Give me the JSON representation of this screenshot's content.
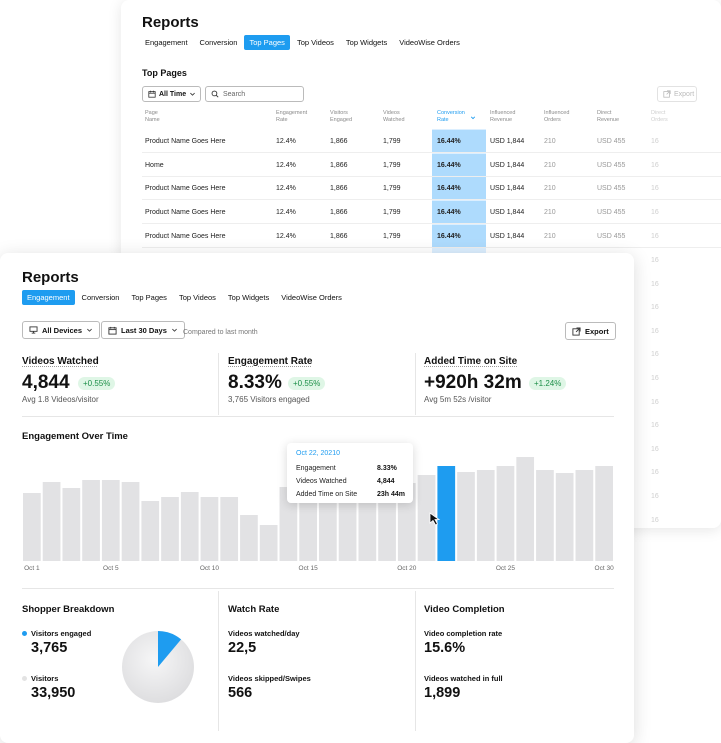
{
  "back": {
    "title": "Reports",
    "tabs": [
      {
        "label": "Engagement",
        "active": false
      },
      {
        "label": "Conversion",
        "active": false
      },
      {
        "label": "Top Pages",
        "active": true
      },
      {
        "label": "Top Videos",
        "active": false
      },
      {
        "label": "Top Widgets",
        "active": false
      },
      {
        "label": "VideoWise Orders",
        "active": false
      }
    ],
    "section_title": "Top Pages",
    "time_filter": "All Time",
    "search_placeholder": "Search",
    "export_label": "Export",
    "columns": [
      {
        "line1": "Page",
        "line2": "Name"
      },
      {
        "line1": "Engagement",
        "line2": "Rate"
      },
      {
        "line1": "Visitors",
        "line2": "Engaged"
      },
      {
        "line1": "Videos",
        "line2": "Watched"
      },
      {
        "line1": "Conversion",
        "line2": "Rate"
      },
      {
        "line1": "Influenced",
        "line2": "Revenue"
      },
      {
        "line1": "Influenced",
        "line2": "Orders"
      },
      {
        "line1": "Direct",
        "line2": "Revenue"
      },
      {
        "line1": "Direct",
        "line2": "Orders"
      }
    ],
    "rows": [
      [
        "Product Name Goes Here",
        "12.4%",
        "1,866",
        "1,799",
        "16.44%",
        "USD 1,844",
        "210",
        "USD 455",
        "16"
      ],
      [
        "Home",
        "12.4%",
        "1,866",
        "1,799",
        "16.44%",
        "USD 1,844",
        "210",
        "USD 455",
        "16"
      ],
      [
        "Product Name Goes Here",
        "12.4%",
        "1,866",
        "1,799",
        "16.44%",
        "USD 1,844",
        "210",
        "USD 455",
        "16"
      ],
      [
        "Product Name Goes Here",
        "12.4%",
        "1,866",
        "1,799",
        "16.44%",
        "USD 1,844",
        "210",
        "USD 455",
        "16"
      ],
      [
        "Product Name Goes Here",
        "12.4%",
        "1,866",
        "1,799",
        "16.44%",
        "USD 1,844",
        "210",
        "USD 455",
        "16"
      ]
    ],
    "direct_orders_extra": [
      "16",
      "16",
      "16",
      "16",
      "16",
      "16",
      "16",
      "16",
      "16",
      "16",
      "16",
      "16"
    ]
  },
  "front": {
    "title": "Reports",
    "tabs": [
      {
        "label": "Engagement",
        "active": true
      },
      {
        "label": "Conversion",
        "active": false
      },
      {
        "label": "Top Pages",
        "active": false
      },
      {
        "label": "Top Videos",
        "active": false
      },
      {
        "label": "Top Widgets",
        "active": false
      },
      {
        "label": "VideoWise Orders",
        "active": false
      }
    ],
    "device_filter": "All Devices",
    "date_filter": "Last 30 Days",
    "compare_text": "Compared to last month",
    "export_label": "Export",
    "metrics": [
      {
        "title": "Videos Watched",
        "value": "4,844",
        "change": "+0.55%",
        "sub": "Avg 1.8 Videos/visitor"
      },
      {
        "title": "Engagement Rate",
        "value": "8.33%",
        "change": "+0.55%",
        "sub": "3,765 Visitors engaged"
      },
      {
        "title": "Added Time on Site",
        "value": "+920h 32m",
        "change": "+1.24%",
        "sub": "Avg 5m 52s /visitor"
      }
    ],
    "chart_title": "Engagement Over Time",
    "tooltip": {
      "date": "Oct 22, 20210",
      "rows": [
        {
          "label": "Engagement",
          "value": "8.33%"
        },
        {
          "label": "Videos Watched",
          "value": "4,844"
        },
        {
          "label": "Added Time on Site",
          "value": "23h 44m"
        }
      ]
    },
    "shopper": {
      "title": "Shopper Breakdown",
      "engaged_label": "Visitors engaged",
      "engaged_value": "3,765",
      "visitors_label": "Visitors",
      "visitors_value": "33,950"
    },
    "watch_rate": {
      "title": "Watch Rate",
      "a_label": "Videos watched/day",
      "a_value": "22,5",
      "b_label": "Videos skipped/Swipes",
      "b_value": "566"
    },
    "completion": {
      "title": "Video Completion",
      "a_label": "Video completion rate",
      "a_value": "15.6%",
      "b_label": "Videos watched in full",
      "b_value": "1,899"
    }
  },
  "colors": {
    "accent": "#1e9cf0",
    "bar": "#e2e2e4",
    "positive": "#1d8f48"
  },
  "chart_data": {
    "type": "bar",
    "x": [
      "Oct 1",
      "Oct 2",
      "Oct 3",
      "Oct 4",
      "Oct 5",
      "Oct 6",
      "Oct 7",
      "Oct 8",
      "Oct 9",
      "Oct 10",
      "Oct 11",
      "Oct 12",
      "Oct 13",
      "Oct 14",
      "Oct 15",
      "Oct 16",
      "Oct 17",
      "Oct 18",
      "Oct 19",
      "Oct 20",
      "Oct 21",
      "Oct 22",
      "Oct 23",
      "Oct 24",
      "Oct 25",
      "Oct 26",
      "Oct 27",
      "Oct 28",
      "Oct 29",
      "Oct 30"
    ],
    "x_tick_labels": [
      "Oct 1",
      "Oct 5",
      "Oct 10",
      "Oct 15",
      "Oct 20",
      "Oct 25",
      "Oct 30"
    ],
    "values": [
      68,
      79,
      73,
      81,
      81,
      79,
      60,
      64,
      69,
      64,
      64,
      46,
      36,
      74,
      73,
      70,
      60,
      68,
      73,
      78,
      86,
      95,
      89,
      91,
      95,
      104,
      91,
      88,
      91,
      95
    ],
    "highlighted": "Oct 22",
    "highlight_color": "#1e9cf0",
    "title": "Engagement Over Time",
    "ylim": [
      0,
      110
    ],
    "grid": false
  }
}
